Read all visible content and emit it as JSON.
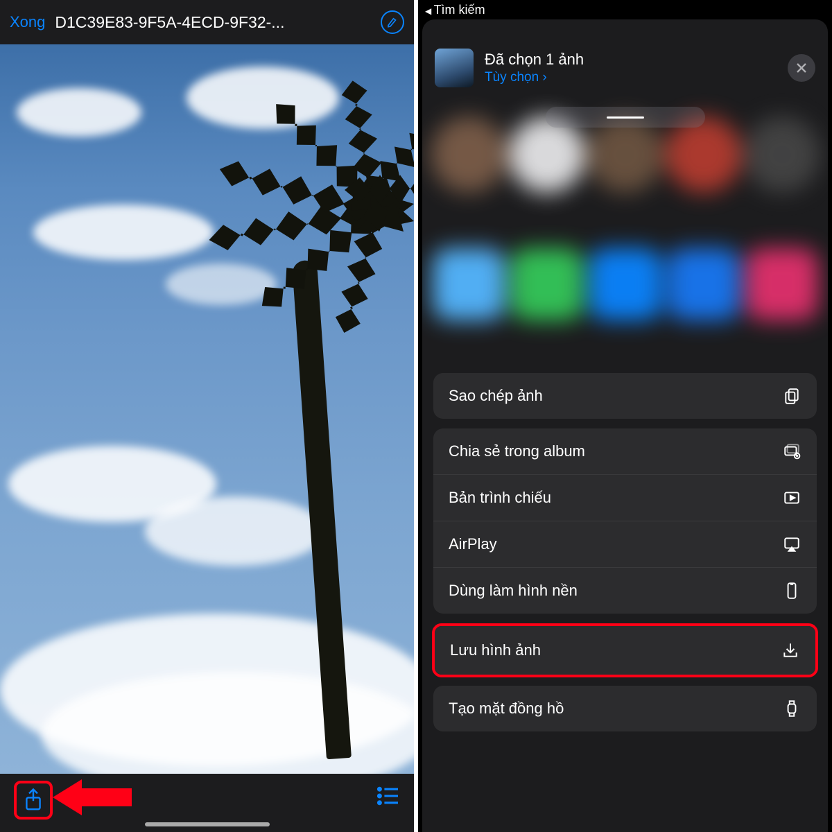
{
  "left": {
    "done_label": "Xong",
    "file_title": "D1C39E83-9F5A-4ECD-9F32-...",
    "icons": {
      "markup": "markup-icon",
      "share": "share-icon",
      "list": "list-icon"
    }
  },
  "right": {
    "breadcrumb": "Tìm kiếm",
    "selected": "Đã chọn 1 ảnh",
    "options": "Tùy chọn",
    "groups": [
      {
        "items": [
          {
            "label": "Sao chép ảnh",
            "icon": "copy-icon"
          }
        ]
      },
      {
        "items": [
          {
            "label": "Chia sẻ trong album",
            "icon": "shared-album-icon"
          },
          {
            "label": "Bản trình chiếu",
            "icon": "play-rect-icon"
          },
          {
            "label": "AirPlay",
            "icon": "airplay-icon"
          },
          {
            "label": "Dùng làm hình nền",
            "icon": "iphone-icon"
          }
        ]
      },
      {
        "highlighted": true,
        "items": [
          {
            "label": "Lưu hình ảnh",
            "icon": "download-icon"
          }
        ]
      },
      {
        "items": [
          {
            "label": "Tạo mặt đồng hồ",
            "icon": "watch-icon"
          }
        ]
      }
    ],
    "app_colors": [
      "#54b6ff",
      "#34c759",
      "#0a84ff",
      "#1877f2",
      "#e1306c"
    ],
    "contact_colors": [
      "#7a5c48",
      "#e4e4e6",
      "#6b5340",
      "#b33b2f",
      "#444"
    ]
  },
  "colors": {
    "accent": "#0a84ff",
    "highlight": "#ff0016"
  }
}
